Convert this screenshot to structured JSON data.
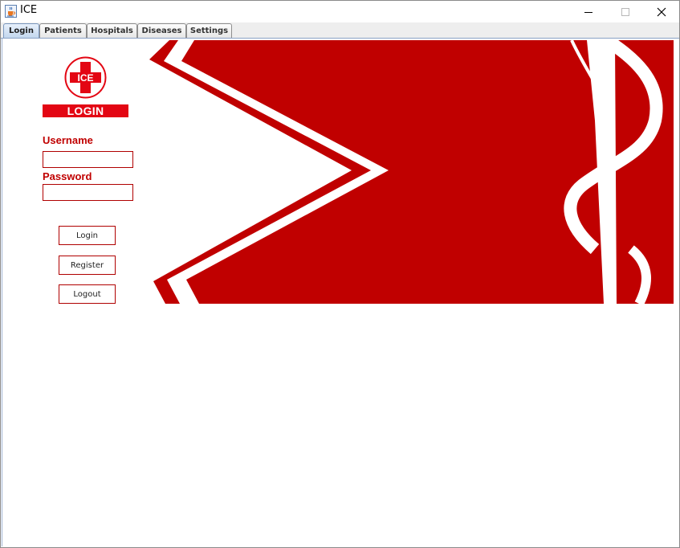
{
  "window": {
    "title": "ICE",
    "app_icon": "java-cup-icon",
    "controls": [
      "minimize-icon",
      "maximize-icon",
      "close-icon"
    ]
  },
  "tabs": [
    {
      "label": "Login",
      "active": true
    },
    {
      "label": "Patients",
      "active": false
    },
    {
      "label": "Hospitals",
      "active": false
    },
    {
      "label": "Diseases",
      "active": false
    },
    {
      "label": "Settings",
      "active": false
    }
  ],
  "login": {
    "logo_text": "ICE",
    "heading": "LOGIN",
    "username_label": "Username",
    "username_value": "",
    "password_label": "Password",
    "password_value": "",
    "buttons": {
      "login": "Login",
      "register": "Register",
      "logout": "Logout"
    }
  },
  "colors": {
    "brand_red": "#c00000",
    "banner_red": "#e30613",
    "tab_active": "#c3d7ee"
  }
}
